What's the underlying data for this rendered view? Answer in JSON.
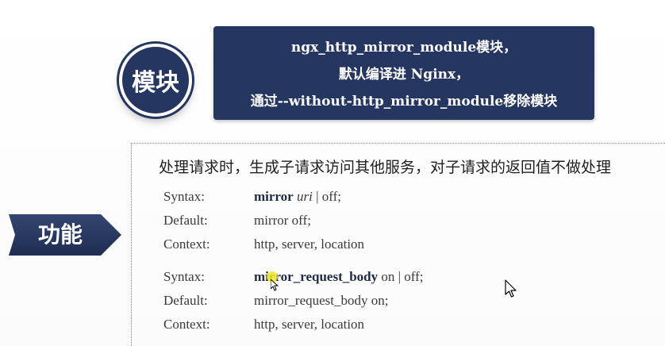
{
  "module_badge": {
    "label": "模块",
    "color": "#253660"
  },
  "module_box": {
    "line1": "ngx_http_mirror_module模块，",
    "line2": "默认编译进 Nginx，",
    "line3": "通过--without-http_mirror_module移除模块"
  },
  "function_tab": {
    "label": "功能"
  },
  "function_panel": {
    "summary": "处理请求时，生成子请求访问其他服务，对子请求的返回值不做处理",
    "directives": [
      {
        "syntax_label": "Syntax:",
        "syntax_keyword": "mirror",
        "syntax_arg": "uri",
        "syntax_rest": " | off;",
        "default_label": "Default:",
        "default_value": "mirror off;",
        "context_label": "Context:",
        "context_value": "http, server, location"
      },
      {
        "syntax_label": "Syntax:",
        "syntax_keyword": "mirror_request_body",
        "syntax_rest": " on | off;",
        "default_label": "Default:",
        "default_value": "mirror_request_body on;",
        "context_label": "Context:",
        "context_value": "http, server, location"
      }
    ]
  },
  "cursors": [
    {
      "icon": "mouse-pointer-icon"
    },
    {
      "icon": "mouse-pointer-icon"
    }
  ]
}
